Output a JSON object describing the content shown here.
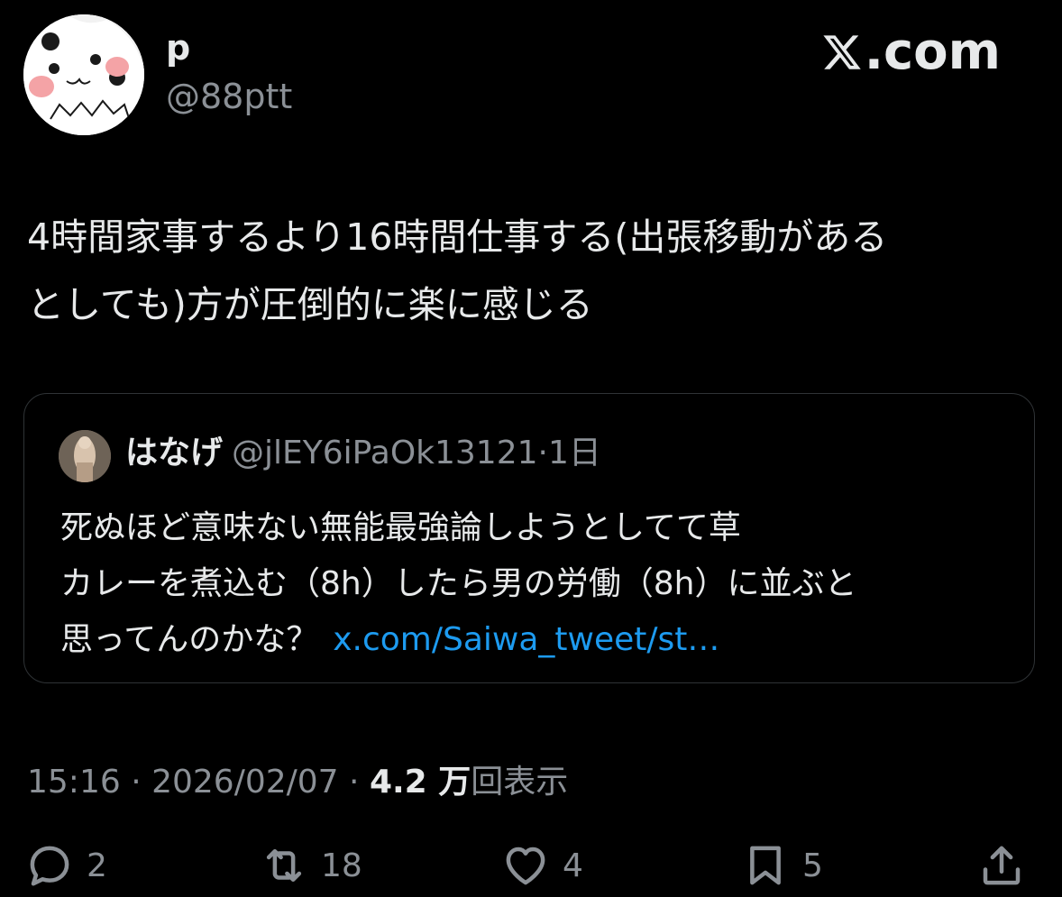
{
  "brand": {
    "domain": ".com",
    "logo_icon": "x-logo-icon"
  },
  "author": {
    "display_name": "p",
    "handle": "@88ptt",
    "avatar_icon": "panda-avatar"
  },
  "tweet": {
    "text": "4時間家事するより16時間仕事する(出張移動がある\nとしても)方が圧倒的に楽に感じる"
  },
  "quote": {
    "display_name": "はなげ",
    "handle": "@jlEY6iPaOk13121",
    "separator": "·",
    "time": "1日",
    "lines": [
      "死ぬほど意味ない無能最強論しようとしてて草",
      "カレーを煮込む（8h）したら男の労働（8h）に並ぶと",
      "思ってんのかな？"
    ],
    "link": "x.com/Saiwa_tweet/st…"
  },
  "meta": {
    "time": "15:16",
    "sep1": " · ",
    "date": "2026/02/07",
    "sep2": " · ",
    "views_num": "4.2 万",
    "views_label": "回表示"
  },
  "actions": {
    "reply_count": "2",
    "retweet_count": "18",
    "like_count": "4",
    "bookmark_count": "5"
  },
  "colors": {
    "background": "#000000",
    "text": "#e7e9ea",
    "secondary": "#8b9096",
    "link": "#1d9bf0",
    "border": "#2f3336"
  }
}
